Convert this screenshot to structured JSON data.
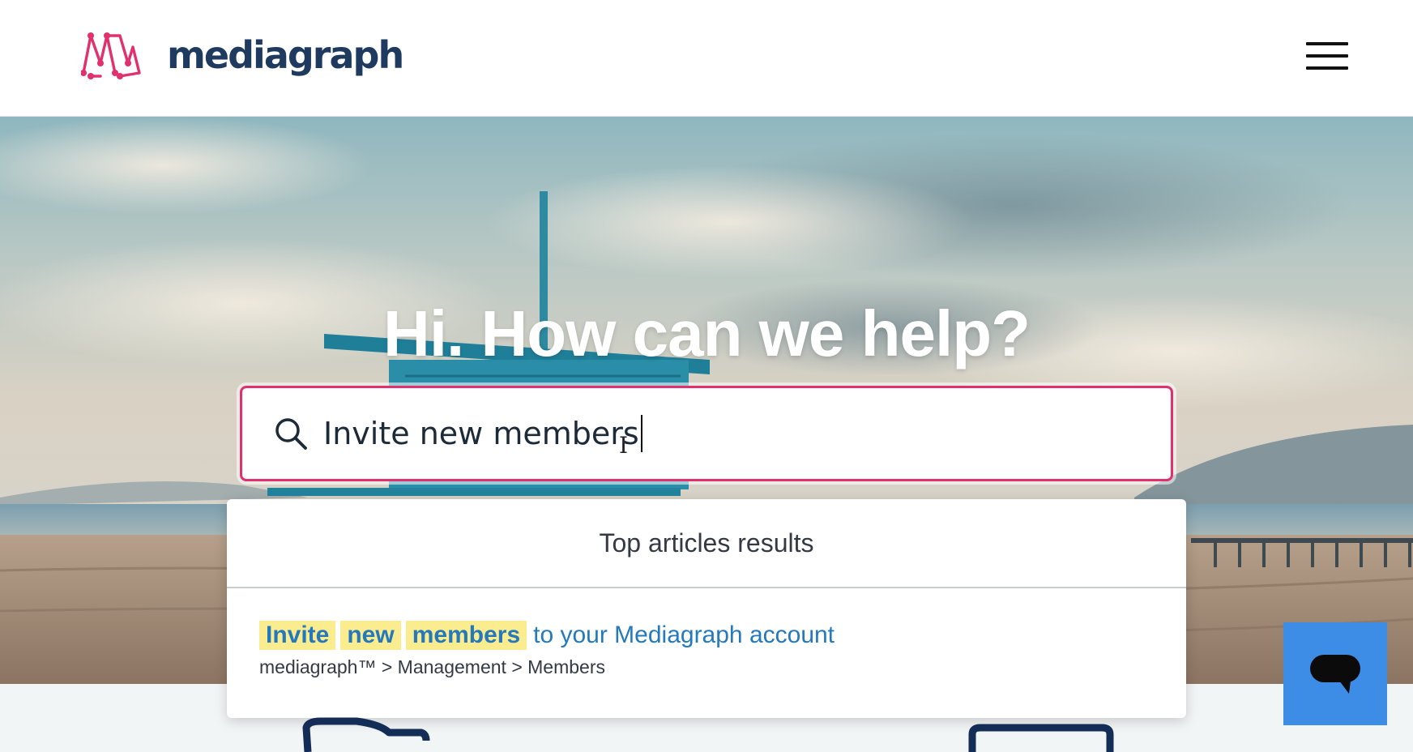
{
  "header": {
    "brand_name": "mediagraph",
    "logo_icon": "mediagraph-logo-icon",
    "menu_icon": "hamburger-menu-icon"
  },
  "hero": {
    "title": "Hi. How can we help?"
  },
  "search": {
    "icon": "search-icon",
    "value": "Invite new members"
  },
  "results": {
    "header": "Top articles results",
    "items": [
      {
        "title_highlights": [
          "Invite",
          "new",
          "members"
        ],
        "title_rest": "to your Mediagraph account",
        "breadcrumb": "mediagraph™ > Management > Members"
      }
    ]
  },
  "chat": {
    "icon": "chat-bubble-icon"
  },
  "colors": {
    "brand_pink": "#e0306e",
    "brand_navy": "#1f3a5f",
    "link_blue": "#2479bd",
    "highlight_yellow": "#fbed8f",
    "chat_blue": "#3d8de6"
  }
}
